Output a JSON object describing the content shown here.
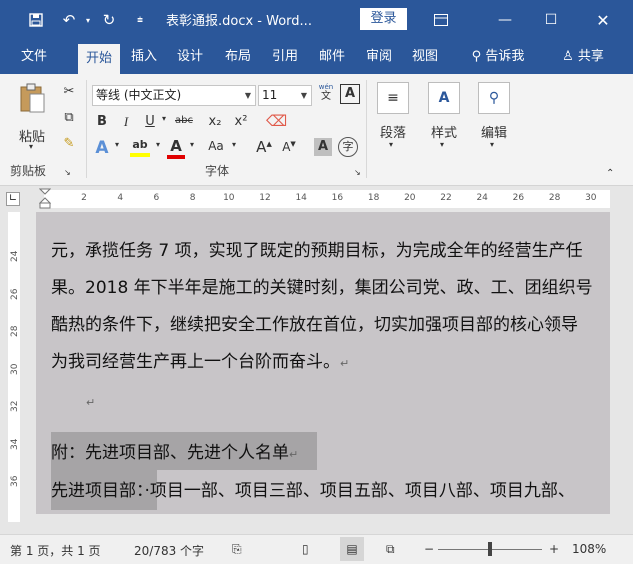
{
  "titlebar": {
    "save_icon": "save-icon",
    "undo_icon": "undo-icon",
    "redo_icon": "redo-icon",
    "customize_icon": "customize-quick-access-icon",
    "title": "表彰通报.docx - Word...",
    "login_label": "登录",
    "ribbon_display_icon": "ribbon-display-options-icon",
    "minimize": "minimize-icon",
    "maximize": "maximize-icon",
    "close": "close-icon",
    "accent": "#2b579a"
  },
  "tabs": [
    {
      "label": "文件"
    },
    {
      "label": "开始"
    },
    {
      "label": "插入"
    },
    {
      "label": "设计"
    },
    {
      "label": "布局"
    },
    {
      "label": "引用"
    },
    {
      "label": "邮件"
    },
    {
      "label": "审阅"
    },
    {
      "label": "视图"
    }
  ],
  "tell_me": {
    "label": "告诉我",
    "icon": "lightbulb-search-icon"
  },
  "share": {
    "label": "共享",
    "icon": "person-share-icon"
  },
  "ribbon": {
    "clipboard": {
      "paste_label": "粘贴",
      "group_label": "剪贴板"
    },
    "font": {
      "font_name": "等线 (中文正文)",
      "font_size": "11",
      "phonetic": "wén",
      "phonetic_char": "文",
      "boxed_a": "A",
      "bold": "B",
      "italic": "I",
      "underline": "U",
      "strike": "abc",
      "subscript": "x₂",
      "superscript": "x²",
      "text_effect": "A",
      "highlight": "ab",
      "font_color": "A",
      "change_case": "Aa",
      "grow": "A",
      "shrink": "A",
      "char_shading": "A",
      "enclose": "字",
      "group_label": "字体"
    },
    "paragraph": {
      "label": "段落"
    },
    "styles": {
      "label": "样式"
    },
    "editing": {
      "label": "编辑"
    }
  },
  "ruler": {
    "ticks": [
      "2",
      "4",
      "6",
      "8",
      "10",
      "12",
      "14",
      "16",
      "18",
      "20",
      "22",
      "24",
      "26",
      "28",
      "30"
    ],
    "vticks": [
      "24",
      "26",
      "28",
      "30",
      "32",
      "34",
      "36"
    ]
  },
  "document": {
    "lines": [
      "元，承揽任务 7 项，实现了既定的预期目标，为完成全年的经营生产任",
      "果。2018 年下半年是施工的关键时刻，集团公司党、政、工、团组织号",
      "酷热的条件下，继续把安全工作放在首位，切实加强项目部的核心领导",
      "为我司经营生产再上一个台阶而奋斗。"
    ],
    "para_mark": "↵",
    "empty_mark": "↵",
    "heading": "附：先进项目部、先进个人名单",
    "list_label": "先进项目部：",
    "list_text": "·项目一部、项目三部、项目五部、项目八部、项目九部、"
  },
  "status": {
    "page": "第 1 页，共 1 页",
    "words": "20/783 个字",
    "zoom": "108%"
  }
}
